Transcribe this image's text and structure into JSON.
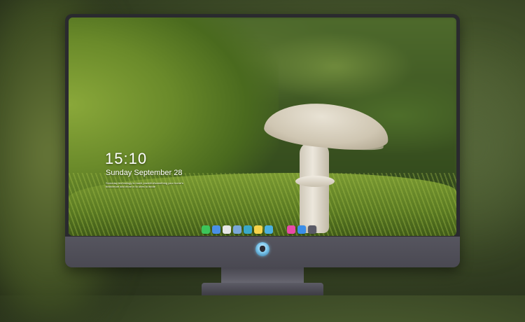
{
  "lockscreen": {
    "time": "15:10",
    "date": "Sunday September 28",
    "note": "Someday technology is much powerful/something your home's brain/more and more in to ones to wrote"
  },
  "dock": {
    "apps": [
      {
        "name": "messages-app",
        "color": "#3cc45a"
      },
      {
        "name": "finder-app",
        "color": "#4a8fe6"
      },
      {
        "name": "safari-app",
        "color": "#e6e6e6"
      },
      {
        "name": "preview-app",
        "color": "#7aa7d8"
      },
      {
        "name": "clapper-app",
        "color": "#3aa8c8"
      },
      {
        "name": "notes-app",
        "color": "#f5d34a"
      },
      {
        "name": "photos-app",
        "color": "#4ab0e0"
      },
      {
        "name": "music-app",
        "color": "#e84aa8"
      },
      {
        "name": "appstore-app",
        "color": "#3a8ee8"
      },
      {
        "name": "camera-app",
        "color": "#5a5a66"
      }
    ]
  },
  "colors": {
    "bezel": "#2a2a2e",
    "chin": "#4a4952",
    "accent": "#7ec8ee"
  }
}
